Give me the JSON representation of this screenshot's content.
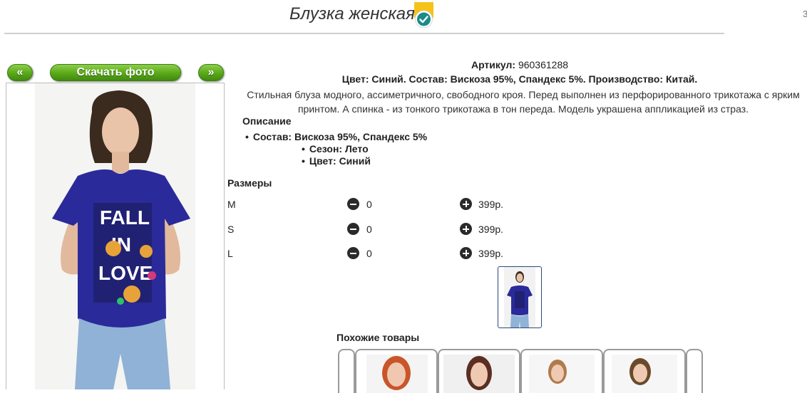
{
  "product": {
    "title": "Блузка женская",
    "sku_label": "Артикул:",
    "sku_value": "960361288",
    "color_line": "Цвет: Синий. Состав: Вискоза 95%, Спандекс 5%. Производство: Китай.",
    "description": "Стильная блуза модного, ассиметричного, свободного кроя. Перед выполнен из перфорированного трикотажа с ярким принтом. А спинка - из тонкого трикотажа в тон переда. Модель украшена аппликацией из страз.",
    "description_heading": "Описание",
    "bullets": [
      "Состав: Вискоза 95%, Спандекс 5%",
      "Сезон: Лето",
      "Цвет: Синий"
    ]
  },
  "gallery": {
    "prev_label": "«",
    "download_label": "Скачать фото",
    "next_label": "»",
    "print_text": [
      "FALL",
      "IN",
      "LOVE"
    ]
  },
  "sizes": {
    "heading": "Размеры",
    "rows": [
      {
        "size": "M",
        "qty": "0",
        "price": "399р."
      },
      {
        "size": "S",
        "qty": "0",
        "price": "399р."
      },
      {
        "size": "L",
        "qty": "0",
        "price": "399р."
      }
    ]
  },
  "similar": {
    "heading": "Похожие товары"
  },
  "misc": {
    "corner_mark": "3"
  },
  "colors": {
    "accent_green": "#5aa71a",
    "badge_yellow": "#f5c218",
    "check_teal": "#1a8a8a",
    "shirt_blue": "#2a2a9a"
  }
}
